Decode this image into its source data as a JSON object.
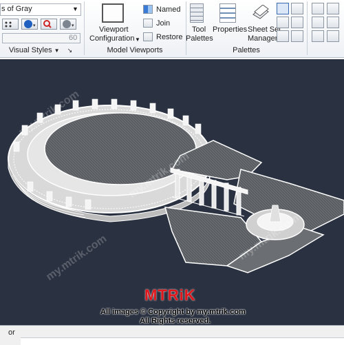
{
  "ribbon": {
    "visual_styles": {
      "dropdown_value": "s of Gray",
      "panel_title": "Visual Styles",
      "field_value": "60"
    },
    "model_viewports": {
      "viewport_config_label_1": "Viewport",
      "viewport_config_label_2": "Configuration",
      "named_label": "Named",
      "join_label": "Join",
      "restore_label": "Restore",
      "panel_title": "Model Viewports"
    },
    "palettes": {
      "tool_palettes_label_1": "Tool",
      "tool_palettes_label_2": "Palettes",
      "properties_label": "Properties",
      "sheet_set_label_1": "Sheet Set",
      "sheet_set_label_2": "Manager",
      "panel_title": "Palettes"
    }
  },
  "overlay": {
    "logo_text": "MTRiK",
    "copyright_line": "All images © Copyright by my.mtrik.com",
    "rights_line": "All Rights reserved.",
    "watermark_text": "my.mtrik.com"
  },
  "command_line": {
    "text": "or"
  },
  "colors": {
    "viewport_bg": "#2a3140",
    "wireframe": "#f2f2f2",
    "logo_red": "#e0161b"
  }
}
